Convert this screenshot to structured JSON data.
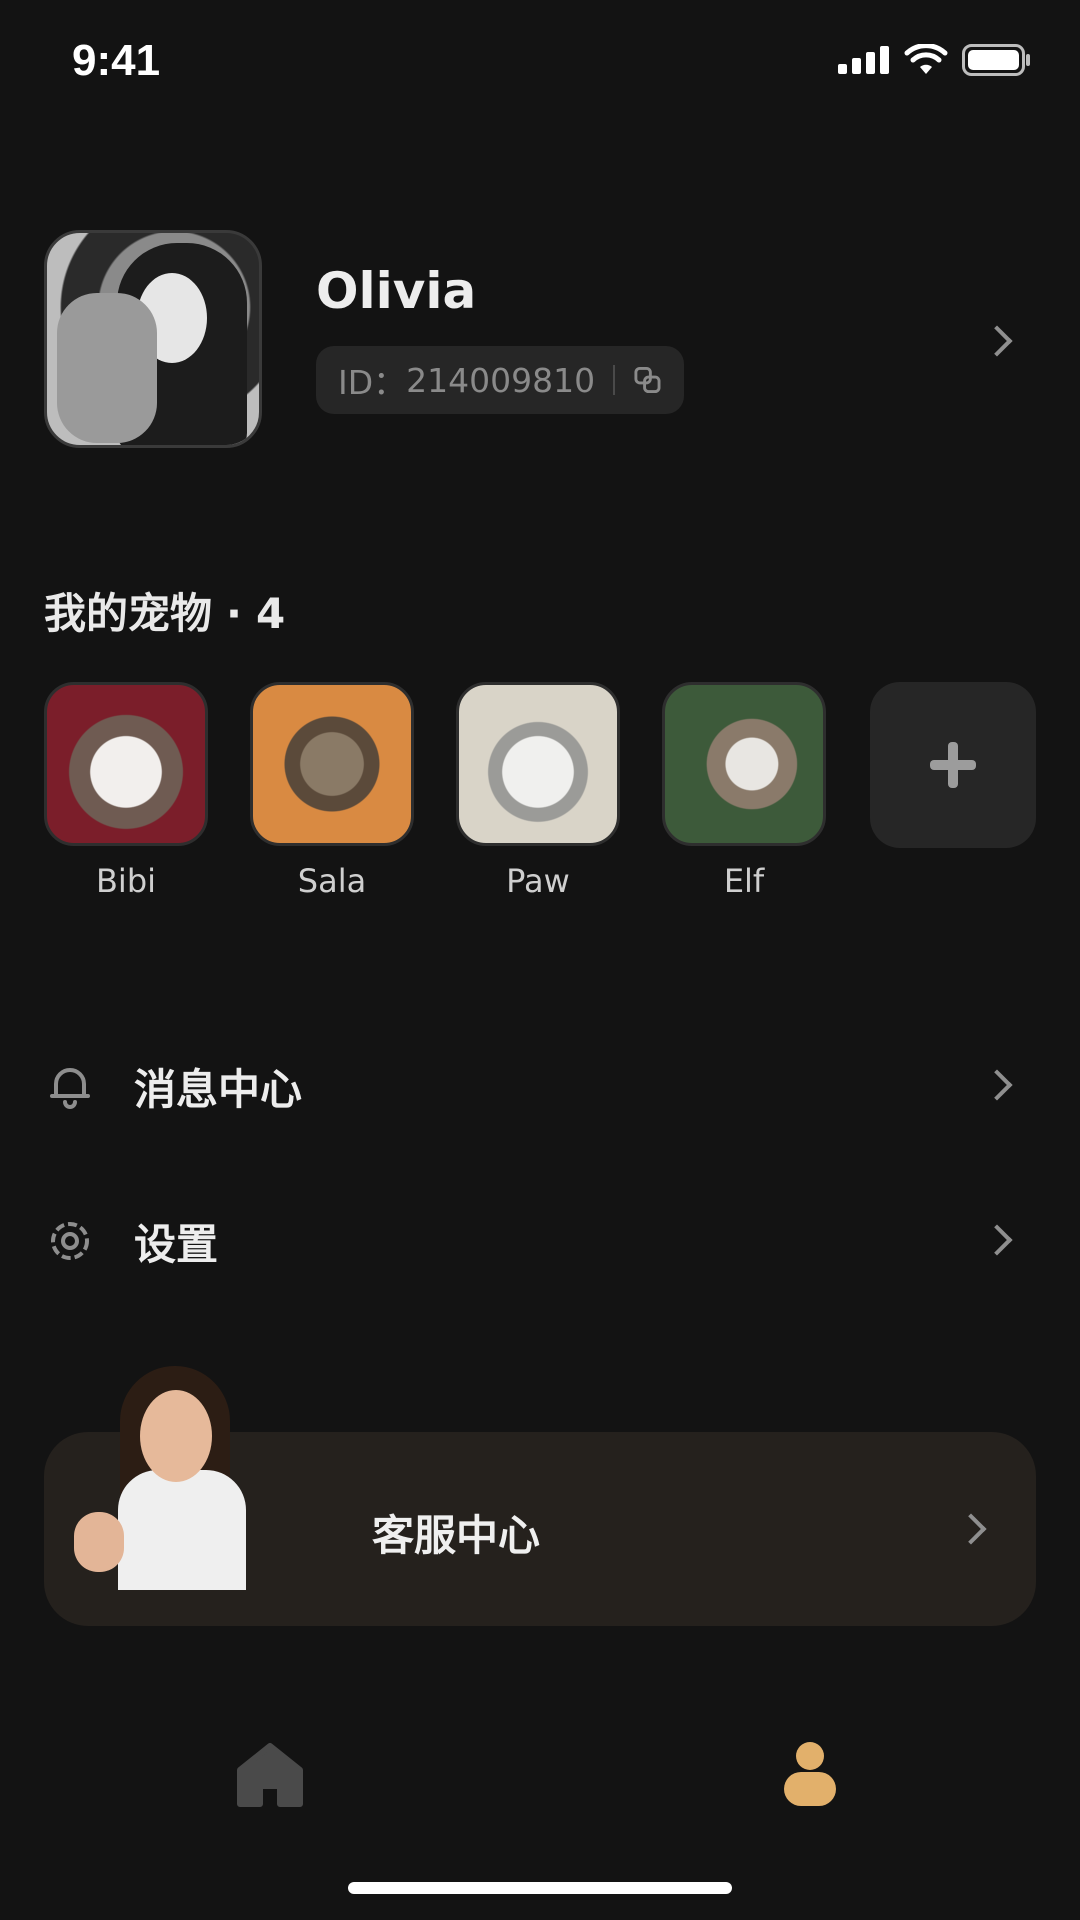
{
  "status_bar": {
    "time": "9:41"
  },
  "profile": {
    "name": "Olivia",
    "id_label": "ID：",
    "id_value": "214009810"
  },
  "pets": {
    "title": "我的宠物",
    "dot": "·",
    "count": "4",
    "items": [
      {
        "name": "Bibi"
      },
      {
        "name": "Sala"
      },
      {
        "name": "Paw"
      },
      {
        "name": "Elf"
      }
    ]
  },
  "menu": {
    "messages": "消息中心",
    "settings": "设置"
  },
  "service": {
    "label": "客服中心"
  },
  "colors": {
    "background": "#131313",
    "card": "#25211d",
    "accent": "#e2b06b",
    "chip": "#262626"
  },
  "icons": {
    "copy": "copy-icon",
    "bell": "bell-icon",
    "gear": "gear-icon",
    "home": "home-icon",
    "profile": "profile-icon"
  }
}
